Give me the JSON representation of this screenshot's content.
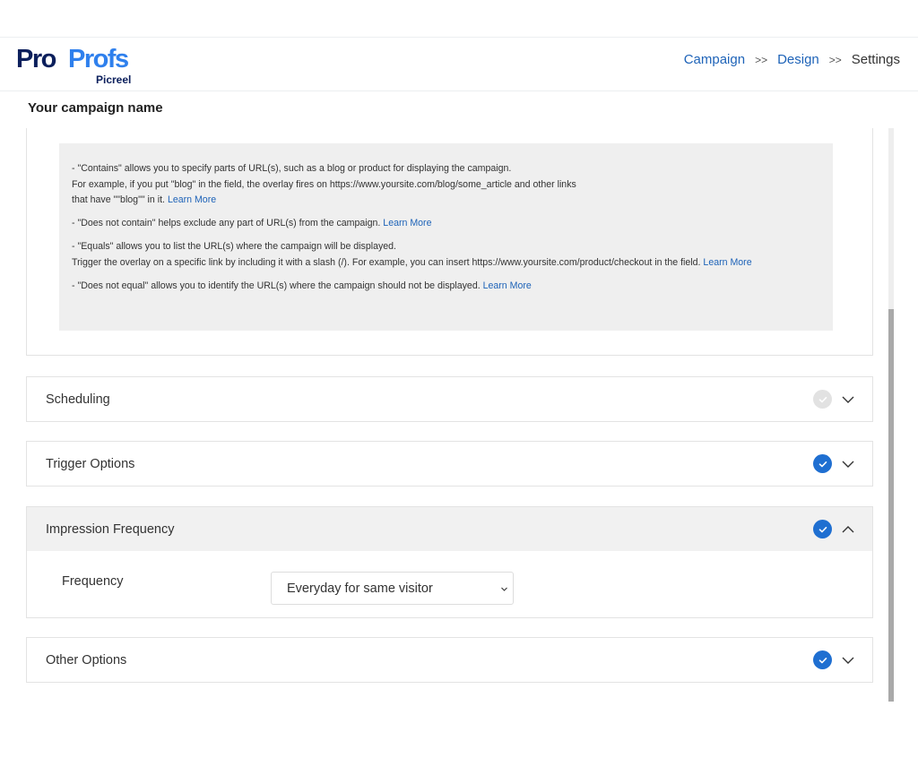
{
  "header": {
    "logo": {
      "part1": "Pro",
      "part2": "Profs",
      "sub": "Picreel"
    },
    "breadcrumb": {
      "campaign": "Campaign",
      "design": "Design",
      "settings": "Settings",
      "separator": ">>"
    }
  },
  "campaign_name": "Your campaign name",
  "url_rules_help": {
    "contains_line1": "- \"Contains\" allows you to specify parts of URL(s), such as a blog or product for displaying the campaign.",
    "contains_line2": "For example, if you put \"blog\" in the field, the overlay fires on https://www.yoursite.com/blog/some_article and other links",
    "contains_line3": "that have \"\"blog\"\" in it.",
    "not_contain": "- \"Does not contain\" helps exclude any part of URL(s) from the campaign.",
    "equals_line1": "- \"Equals\" allows you to list the URL(s) where the campaign will be displayed.",
    "equals_line2": "Trigger the overlay on a specific link by including it with a slash (/). For example, you can insert https://www.yoursite.com/product/checkout in the field.",
    "not_equal": "- \"Does not equal\" allows you to identify the URL(s) where the campaign should not be displayed.",
    "learn_more": "Learn More"
  },
  "sections": {
    "scheduling": {
      "title": "Scheduling",
      "complete": false,
      "expanded": false
    },
    "trigger_options": {
      "title": "Trigger Options",
      "complete": true,
      "expanded": false
    },
    "impression_frequency": {
      "title": "Impression Frequency",
      "complete": true,
      "expanded": true,
      "frequency_label": "Frequency",
      "frequency_value": "Everyday for same visitor"
    },
    "other_options": {
      "title": "Other Options",
      "complete": true,
      "expanded": false
    }
  },
  "colors": {
    "accent_blue": "#1f6fd1",
    "link_blue": "#1e63b8",
    "logo_dark": "#0b1f5c",
    "logo_light": "#2f80ed",
    "incomplete_grey": "#e2e2e2"
  }
}
